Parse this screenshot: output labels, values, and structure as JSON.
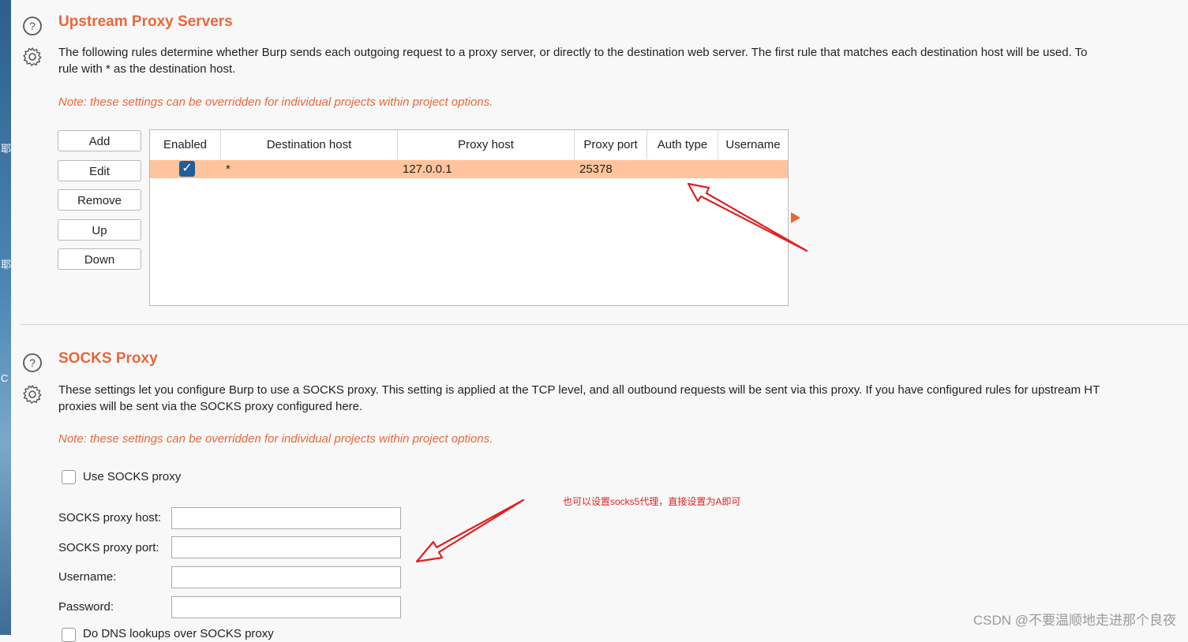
{
  "side": {
    "char1": "耶",
    "char2": "耶",
    "char3": "C"
  },
  "upstream": {
    "title": "Upstream Proxy Servers",
    "desc_line1": "The following rules determine whether Burp sends each outgoing request to a proxy server, or directly to the destination web server. The first rule that matches each destination host will be used. To",
    "desc_line2": "rule with * as the destination host.",
    "note": "Note: these settings can be overridden for individual projects within project options.",
    "buttons": {
      "add": "Add",
      "edit": "Edit",
      "remove": "Remove",
      "up": "Up",
      "down": "Down"
    },
    "columns": {
      "enabled": "Enabled",
      "destination_host": "Destination host",
      "proxy_host": "Proxy host",
      "proxy_port": "Proxy port",
      "auth_type": "Auth type",
      "username": "Username"
    },
    "rows": [
      {
        "enabled": true,
        "destination_host": "*",
        "proxy_host": "127.0.0.1",
        "proxy_port": "25378",
        "auth_type": "",
        "username": ""
      }
    ]
  },
  "socks": {
    "title": "SOCKS Proxy",
    "desc_line1": "These settings let you configure Burp to use a SOCKS proxy. This setting is applied at the TCP level, and all outbound requests will be sent via this proxy. If you have configured rules for upstream HT",
    "desc_line2": "proxies will be sent via the SOCKS proxy configured here.",
    "note": "Note: these settings can be overridden for individual projects within project options.",
    "use_socks_label": "Use SOCKS proxy",
    "use_socks_checked": false,
    "host_label": "SOCKS proxy host:",
    "host_value": "",
    "port_label": "SOCKS proxy port:",
    "port_value": "",
    "username_label": "Username:",
    "username_value": "",
    "password_label": "Password:",
    "password_value": "",
    "dns_label": "Do DNS lookups over SOCKS proxy"
  },
  "annotation": "也可以设置socks5代理，直接设置为A即可",
  "watermark": "CSDN @不要温顺地走进那个良夜",
  "colors": {
    "accent": "#e8673a",
    "selected_row": "#ffc49c",
    "checkbox": "#1f5e9b",
    "arrow": "#e02020"
  },
  "icons": {
    "help": "help-circle-icon",
    "settings": "gear-icon",
    "expand": "triangle-right-icon"
  }
}
